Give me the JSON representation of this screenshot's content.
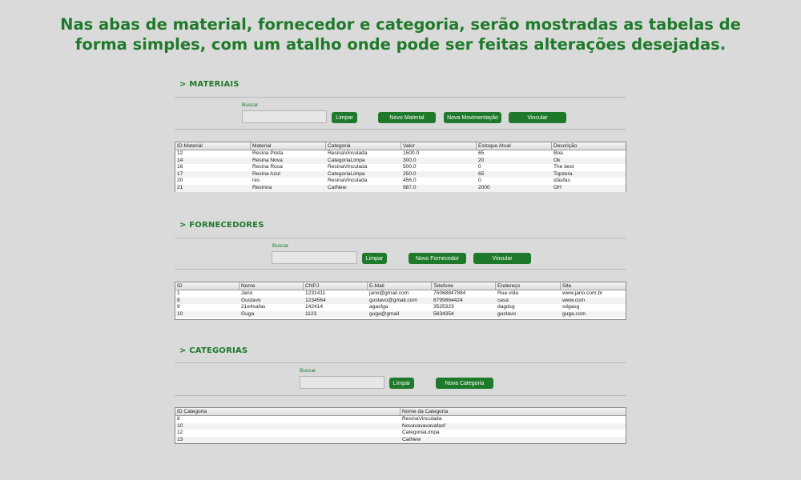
{
  "headline": {
    "line1": "Nas abas de material, fornecedor e categoria, serão mostradas as tabelas de",
    "line2": "forma simples, com um atalho onde pode ser feitas alterações desejadas."
  },
  "materiais": {
    "title": "> MATERIAIS",
    "search_label": "Buscar",
    "search_value": "",
    "buttons": {
      "limpar": "Limpar",
      "novo": "Novo Material",
      "movimentacao": "Nova Movimentação",
      "vincular": "Vincular"
    },
    "columns": [
      "ID Material",
      "Material",
      "Categoria",
      "Valor",
      "Estoque Atual",
      "Descrição"
    ],
    "rows": [
      [
        "12",
        "Resina Preta",
        "ResinaVinculada",
        "1500.0",
        "65",
        "Boa"
      ],
      [
        "14",
        "Resina Nova",
        "CategoriaLimpa",
        "300.0",
        "20",
        "Ok"
      ],
      [
        "16",
        "Resina Rosa",
        "ResinaVinculada",
        "500.0",
        "0",
        "The best"
      ],
      [
        "17",
        "Resina Azul",
        "CategoriaLimpa",
        "250.0",
        "65",
        "Topzera"
      ],
      [
        "20",
        "res",
        "ResinaVinculada",
        "456.0",
        "0",
        "sfasfas"
      ],
      [
        "21",
        "Resinna",
        "CatNew",
        "987.0",
        "2000",
        "OH"
      ]
    ]
  },
  "fornecedores": {
    "title": "> FORNECEDORES",
    "search_label": "Buscar",
    "search_value": "",
    "buttons": {
      "limpar": "Limpar",
      "novo": "Novo Fornecedor",
      "vincular": "Vincular"
    },
    "columns": [
      "ID",
      "Nome",
      "CNPJ",
      "E-Mail",
      "Telefone",
      "Endereço",
      "Site"
    ],
    "rows": [
      [
        "1",
        "Jario",
        "1231411",
        "jario@gmail.com",
        "75068847884",
        "Rua vida",
        "www.jario.com.br"
      ],
      [
        "8",
        "Gustavo",
        "1234564",
        "gustavo@gmail.com",
        "8799864424",
        "casa",
        "www.com"
      ],
      [
        "9",
        "21e4safas",
        "142414",
        "agasfga",
        "3525323",
        "dagdsg",
        "sdgasg"
      ],
      [
        "10",
        "Guga",
        "1123",
        "guga@gmail",
        "5634354",
        "gustavo",
        "guga.com"
      ]
    ]
  },
  "categorias": {
    "title": "> CATEGORIAS",
    "search_label": "Buscar",
    "search_value": "",
    "buttons": {
      "limpar": "Limpar",
      "nova": "Nova Categoria"
    },
    "columns": [
      "ID Categoria",
      "Nome da Categoria"
    ],
    "rows": [
      [
        "8",
        "ResinaVinculada"
      ],
      [
        "10",
        "Novavavavavafasf"
      ],
      [
        "12",
        "CategoriaLimpa"
      ],
      [
        "13",
        "CatNew"
      ]
    ]
  },
  "colors": {
    "accent": "#1e7a2a",
    "background": "#dadada"
  }
}
